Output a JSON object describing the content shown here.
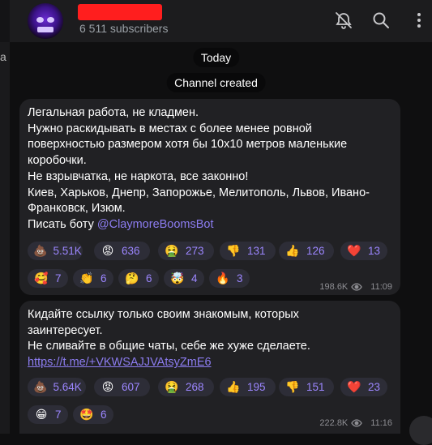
{
  "channel": {
    "subscribers": "6 511 subscribers"
  },
  "header_icons": [
    "mute-bell-icon",
    "search-icon",
    "more-vertical-icon"
  ],
  "left_edge_glyph": "a",
  "date_pill": "Today",
  "service_pill": "Channel created",
  "posts": [
    {
      "lines": [
        "Легальная работа, не кладмен.",
        "Нужно раскидывать в местах с более менее ровной",
        "поверхностью размером хотя бы 10х10 метров маленькие",
        "коробочки.",
        "Не взрывчатка, не наркота, все законно!",
        "Киев, Харьков, Днепр, Запорожье, Мелитополь, Львов, Ивано-",
        "Франковск, Изюм."
      ],
      "last_line_prefix": "Писать боту ",
      "last_line_link": "@ClaymoreBoomsBot",
      "reactions": [
        {
          "emoji": "💩",
          "count": "5.51K"
        },
        {
          "emoji": "😡",
          "count": "636"
        },
        {
          "emoji": "🤮",
          "count": "273"
        },
        {
          "emoji": "👎",
          "count": "131"
        },
        {
          "emoji": "👍",
          "count": "126"
        },
        {
          "emoji": "❤️",
          "count": "13"
        },
        {
          "emoji": "🥰",
          "count": "7"
        },
        {
          "emoji": "👏",
          "count": "6"
        },
        {
          "emoji": "🤔",
          "count": "6"
        },
        {
          "emoji": "🤯",
          "count": "4"
        },
        {
          "emoji": "🔥",
          "count": "3"
        }
      ],
      "views": "198.6K",
      "time": "11:09"
    },
    {
      "lines": [
        "Кидайте ссылку только своим знакомым, которых",
        "заинтересует.",
        "Не сливайте в общие чаты, себе же хуже сделаете."
      ],
      "link": "https://t.me/+VKWSAJJVAtsyZmE6",
      "reactions": [
        {
          "emoji": "💩",
          "count": "5.64K"
        },
        {
          "emoji": "😡",
          "count": "607"
        },
        {
          "emoji": "🤮",
          "count": "268"
        },
        {
          "emoji": "👍",
          "count": "195"
        },
        {
          "emoji": "👎",
          "count": "151"
        },
        {
          "emoji": "❤️",
          "count": "23"
        },
        {
          "emoji": "😁",
          "count": "7"
        },
        {
          "emoji": "🤩",
          "count": "6"
        }
      ],
      "views": "222.8K",
      "time": "11:16"
    }
  ]
}
